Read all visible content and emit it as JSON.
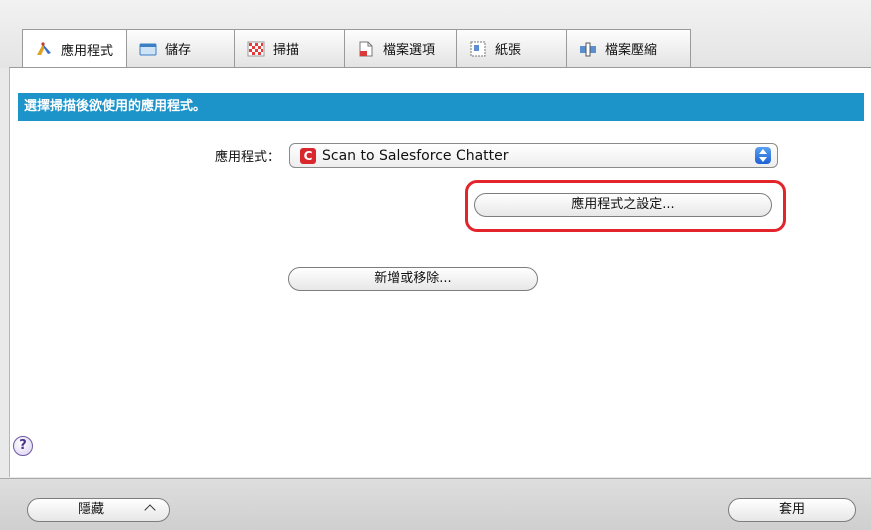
{
  "tabs": [
    {
      "label": "應用程式",
      "icon": "application-icon",
      "active": true
    },
    {
      "label": "儲存",
      "icon": "save-folder-icon"
    },
    {
      "label": "掃描",
      "icon": "scan-pattern-icon"
    },
    {
      "label": "檔案選項",
      "icon": "file-options-icon"
    },
    {
      "label": "紙張",
      "icon": "paper-icon"
    },
    {
      "label": "檔案壓縮",
      "icon": "file-compression-icon"
    }
  ],
  "header": {
    "title": "選擇掃描後欲使用的應用程式。"
  },
  "application": {
    "label": "應用程式：",
    "selected": "Scan to Salesforce Chatter",
    "selected_icon": "salesforce-chatter-icon"
  },
  "buttons": {
    "app_settings": "應用程式之設定...",
    "add_remove": "新增或移除...",
    "hide": "隱藏",
    "apply": "套用"
  },
  "help": {
    "symbol": "?"
  },
  "colors": {
    "header_bar": "#1c93c9",
    "highlight": "#e3242b"
  }
}
